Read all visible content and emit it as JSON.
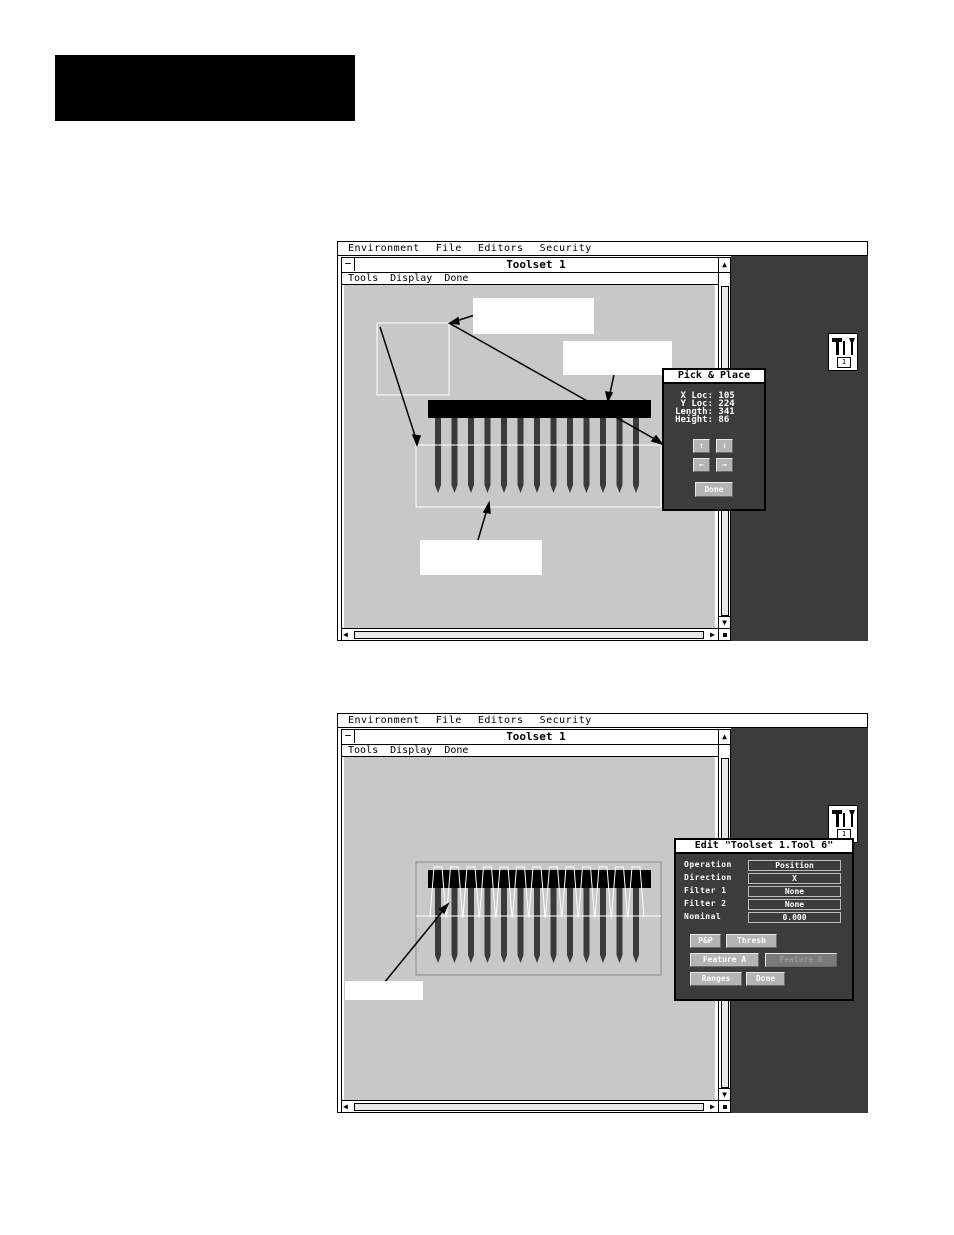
{
  "app": {
    "menu": [
      "Environment",
      "File",
      "Editors",
      "Security"
    ],
    "window_title": "Toolset 1",
    "window_menu": [
      "Tools",
      "Display",
      "Done"
    ],
    "icon_number": "1"
  },
  "pick_place_dialog": {
    "title": "Pick & Place",
    "x_loc_label": "X Loc:",
    "x_loc": "105",
    "y_loc_label": "Y Loc:",
    "y_loc": "224",
    "length_label": "Length:",
    "length": "341",
    "height_label": "Height:",
    "height": "86",
    "arrows": [
      "↑",
      "↓",
      "←",
      "→"
    ],
    "done_label": "Done"
  },
  "edit_dialog": {
    "title": "Edit \"Toolset 1.Tool 6\"",
    "rows": [
      {
        "label": "Operation",
        "value": "Position"
      },
      {
        "label": "Direction",
        "value": "X"
      },
      {
        "label": "Filter 1",
        "value": "None"
      },
      {
        "label": "Filter 2",
        "value": "None"
      },
      {
        "label": "Nominal",
        "value": "0.000"
      }
    ],
    "buttons": {
      "pp": "P&P",
      "thresh": "Thresh",
      "feature_a": "Feature A",
      "feature_b": "Feature B",
      "ranges": "Ranges",
      "done": "Done"
    }
  },
  "colors": {
    "desktop": "#3c3c3c",
    "canvas": "#c8c8c8",
    "button": "#b4b4b4"
  }
}
